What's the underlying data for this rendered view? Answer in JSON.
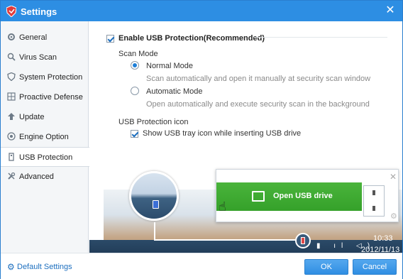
{
  "window": {
    "title": "Settings",
    "close": "✕",
    "accent": "#2d8ee3"
  },
  "sidebar": {
    "items": [
      {
        "label": "General",
        "icon": "gear-icon",
        "active": false
      },
      {
        "label": "Virus Scan",
        "icon": "magnifier-icon",
        "active": false
      },
      {
        "label": "System Protection",
        "icon": "shield-icon",
        "active": false
      },
      {
        "label": "Proactive Defense",
        "icon": "grid-icon",
        "active": false
      },
      {
        "label": "Update",
        "icon": "upload-arrow-icon",
        "active": false
      },
      {
        "label": "Engine Option",
        "icon": "engine-icon",
        "active": false
      },
      {
        "label": "USB Protection",
        "icon": "usb-icon",
        "active": true
      },
      {
        "label": "Advanced",
        "icon": "wrench-icon",
        "active": false
      }
    ]
  },
  "main": {
    "enable_label": "Enable USB Protection(Recommended)",
    "enable_checked": true,
    "scan_mode_heading": "Scan Mode",
    "modes": [
      {
        "label": "Normal Mode",
        "description": "Scan automatically and open it manually at security scan window",
        "selected": true
      },
      {
        "label": "Automatic Mode",
        "description": "Open automatically and execute security scan in the background",
        "selected": false
      }
    ],
    "icon_heading": "USB Protection icon",
    "tray_icon_label": "Show USB tray icon while inserting USB drive",
    "tray_icon_checked": true
  },
  "preview": {
    "open_usb_label": "Open USB drive",
    "button_color": "#3faa32",
    "close_glyph": "✕",
    "gear_glyph": "⚙",
    "tray_glyphs": "▮ ıl ◁)",
    "clock_time": "10:33",
    "clock_date": "2012/11/13"
  },
  "footer": {
    "default_settings": "Default Settings",
    "ok": "OK",
    "cancel": "Cancel"
  }
}
